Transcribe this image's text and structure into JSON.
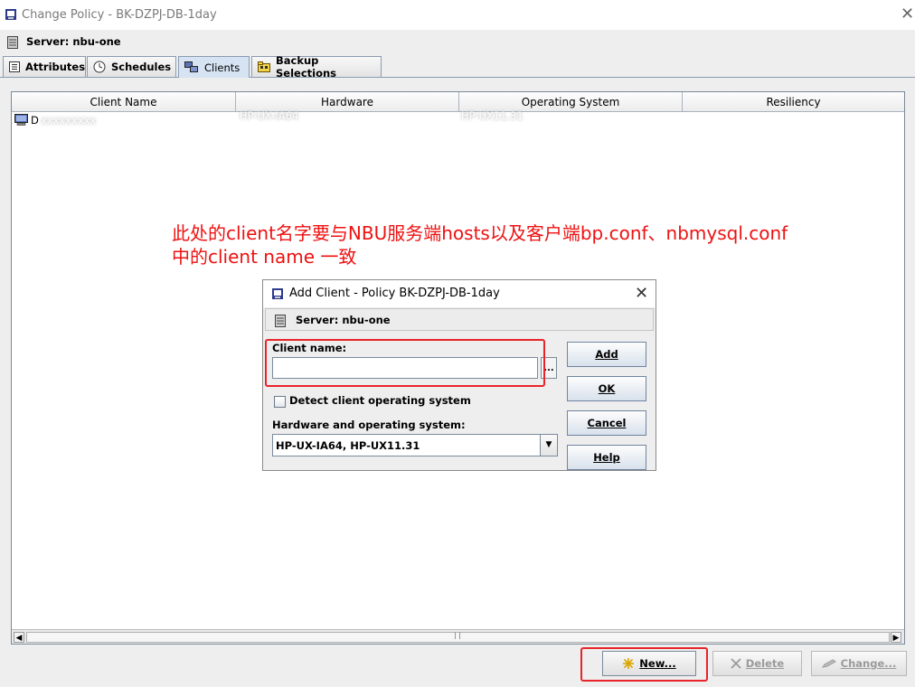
{
  "window": {
    "title": "Change Policy - BK-DZPJ-DB-1day",
    "close_glyph": "✕"
  },
  "server": {
    "label": "Server: nbu-one"
  },
  "tabs": [
    {
      "label": "Attributes",
      "icon": "list-icon"
    },
    {
      "label": "Schedules",
      "icon": "clock-icon"
    },
    {
      "label": "Clients",
      "icon": "computers-icon",
      "active": true
    },
    {
      "label": "Backup Selections",
      "icon": "folder-icon"
    }
  ],
  "table": {
    "columns": [
      "Client Name",
      "Hardware",
      "Operating System",
      "Resiliency"
    ],
    "rows": [
      {
        "client": "D",
        "client_hidden": "xxxxxxxxx",
        "hardware": "HP-UX-IA64",
        "os": "HP-UX11.31",
        "resiliency": ""
      }
    ]
  },
  "annotation": {
    "line1": "此处的client名字要与NBU服务端hosts以及客户端bp.conf、nbmysql.conf",
    "line2": "中的client name 一致"
  },
  "footer": {
    "new_label": "New...",
    "delete_label": "Delete",
    "change_label": "Change..."
  },
  "dialog": {
    "title": "Add Client - Policy BK-DZPJ-DB-1day",
    "close_glyph": "✕",
    "server_label": "Server: nbu-one",
    "client_name_label": "Client name:",
    "client_name_value": "",
    "browse_label": "...",
    "detect_label": "Detect client operating system",
    "detect_checked": false,
    "hw_os_label": "Hardware and operating system:",
    "hw_os_value": "HP-UX-IA64, HP-UX11.31",
    "buttons": {
      "add": "Add",
      "ok": "OK",
      "cancel": "Cancel",
      "help": "Help"
    }
  },
  "colors": {
    "highlight": "#e8242a",
    "annotation": "#ee1111",
    "active_tab": "#d6e3f3"
  }
}
